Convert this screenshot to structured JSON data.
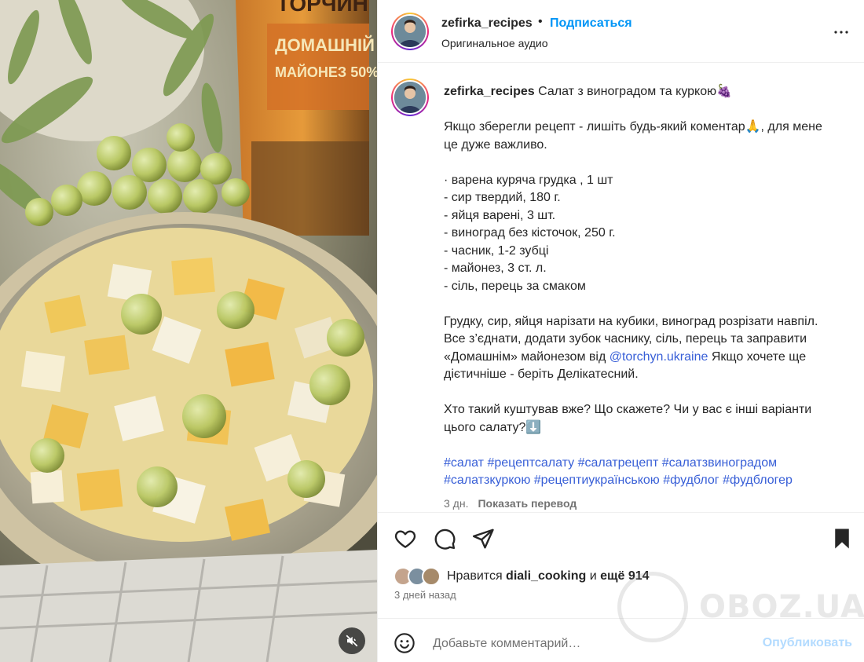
{
  "media": {
    "package_brand": "ТОРЧИН",
    "package_title": "ДОМАШНІЙ",
    "package_sub": "МАЙОНЕЗ 50%",
    "mute_icon": "speaker-muted-icon"
  },
  "header": {
    "username": "zefirka_recipes",
    "separator": "•",
    "follow_label": "Подписаться",
    "audio_label": "Оригинальное аудио",
    "more_icon": "more-horizontal-icon"
  },
  "caption": {
    "username": "zefirka_recipes",
    "title": "Салат з виноградом та куркою🍇",
    "intro": "Якщо зберегли рецепт - лишіть будь-який коментар🙏, для мене це дуже важливо.",
    "ingredients": [
      "· варена куряча грудка , 1 шт",
      "- сир твердий, 180 г.",
      "- яйця варені, 3 шт.",
      "- виноград без кісточок, 250 г.",
      "- часник, 1-2 зубці",
      "- майонез, 3 ст. л.",
      "- сіль, перець за смаком"
    ],
    "method_before_mention": "Грудку, сир, яйця нарізати на кубики, виноград розрізати навпіл. Все з’єднати, додати зубок часнику, сіль, перець та заправити «Домашнім» майонезом від ",
    "mention": "@torchyn.ukraine",
    "method_after_mention": " Якщо хочете ще дієтичніше - беріть Делікатесний.",
    "question": "Хто такий куштував вже? Що скажете? Чи у вас є інші варіанти цього салату?⬇️",
    "hashtags": [
      "#салат",
      "#рецептсалату",
      "#салатрецепт",
      "#салатзвиноградом",
      "#салатзкуркою",
      "#рецептиукраїнською",
      "#фудблог",
      "#фудблогер"
    ],
    "age": "3 дн.",
    "translate_label": "Показать перевод"
  },
  "actions": {
    "like_icon": "heart-icon",
    "comment_icon": "comment-icon",
    "share_icon": "share-icon",
    "save_icon": "bookmark-icon"
  },
  "likes": {
    "prefix": "Нравится ",
    "user": "diali_cooking",
    "middle": " и ",
    "count": "ещё 914"
  },
  "date_label": "3 дней назад",
  "comment": {
    "emoji_icon": "emoji-smile-icon",
    "placeholder": "Добавьте комментарий…",
    "publish_label": "Опубликовать"
  },
  "watermark": "OBOZ.UA"
}
